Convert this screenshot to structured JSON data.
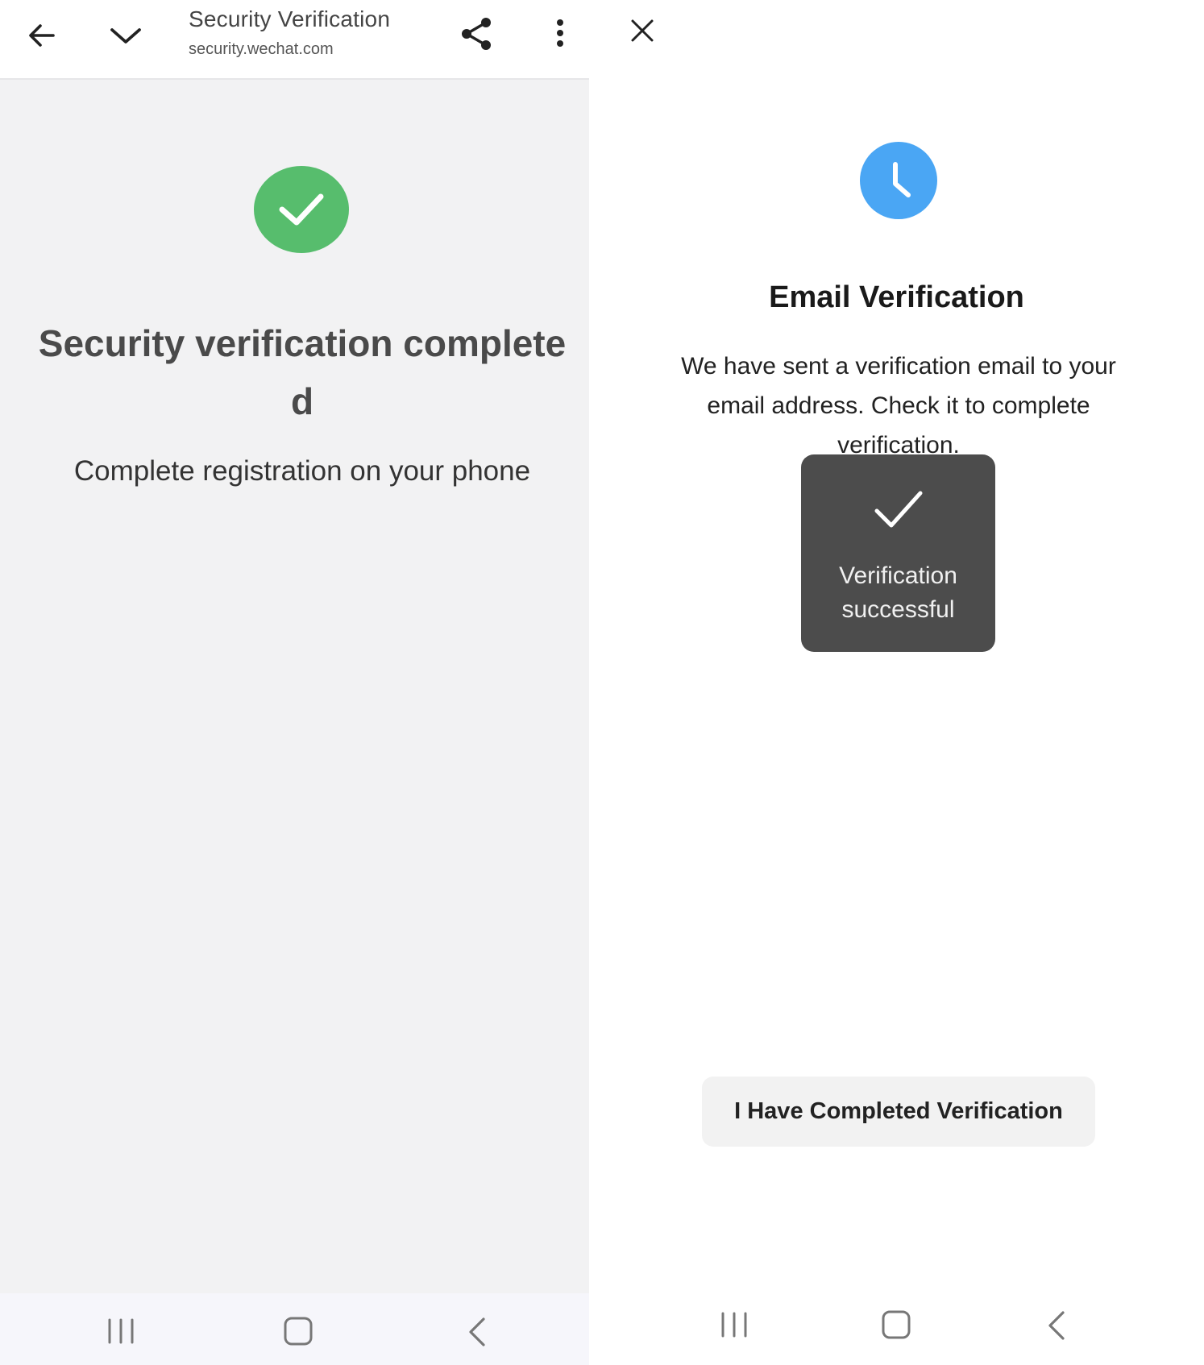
{
  "left_panel": {
    "toolbar": {
      "title": "Security Verification",
      "url": "security.wechat.com",
      "icons": [
        "back-arrow-icon",
        "chevron-down-icon",
        "share-icon",
        "more-vert-icon"
      ]
    },
    "status_icon": "check-icon",
    "title": "Security verification completed",
    "subtitle": "Complete registration on your phone",
    "nav_icons": [
      "recents-icon",
      "home-icon",
      "back-icon"
    ]
  },
  "right_panel": {
    "close_icon": "close-icon",
    "status_icon": "clock-icon",
    "title": "Email Verification",
    "description": "We have sent a verification email to your email address. Check it to complete verification.",
    "toast": {
      "icon": "check-icon",
      "text": "Verification successful"
    },
    "button_label": "I Have Completed Verification",
    "nav_icons": [
      "recents-icon",
      "home-icon",
      "back-icon"
    ]
  },
  "colors": {
    "success_green": "#57bd6d",
    "clock_blue": "#4aa6f4",
    "toast_bg": "#4c4c4c",
    "left_bg": "#f2f2f3"
  }
}
